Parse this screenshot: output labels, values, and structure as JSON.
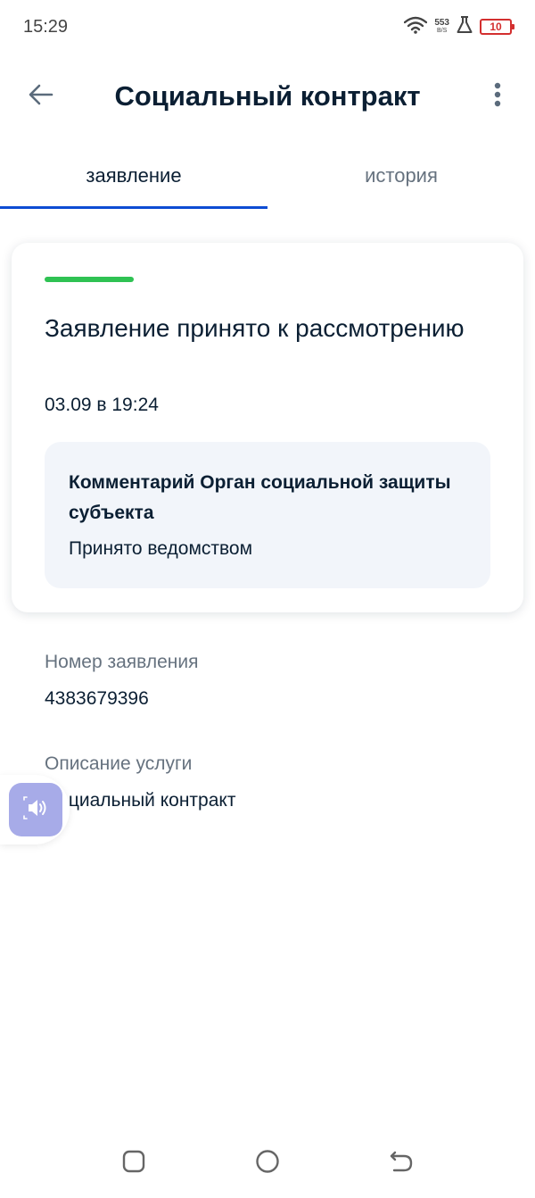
{
  "status_bar": {
    "time": "15:29",
    "net_speed": "553",
    "net_unit": "B/S",
    "battery": "10",
    "battery_color": "#d32f2f"
  },
  "app_bar": {
    "title": "Социальный контракт",
    "back_icon": "arrow-left-icon",
    "menu_icon": "more-vertical-icon"
  },
  "tabs": [
    {
      "label": "заявление",
      "active": true
    },
    {
      "label": "история",
      "active": false
    }
  ],
  "status_card": {
    "status_color": "#2fc253",
    "title": "Заявление принято к рассмотрению",
    "date": "03.09 в 19:24",
    "comment": {
      "title": "Комментарий Орган социальной защиты субъекта",
      "text": "Принято ведомством"
    }
  },
  "details": {
    "number_label": "Номер заявления",
    "number_value": "4383679396",
    "service_label": "Описание услуги",
    "service_value": "Социальный контракт"
  },
  "accessibility": {
    "icon": "speaker-icon",
    "color": "#a7abe8"
  },
  "colors": {
    "accent": "#0d4cd3",
    "text": "#0b1f33",
    "secondary_text": "#66727f",
    "comment_bg": "#f2f5fa"
  }
}
